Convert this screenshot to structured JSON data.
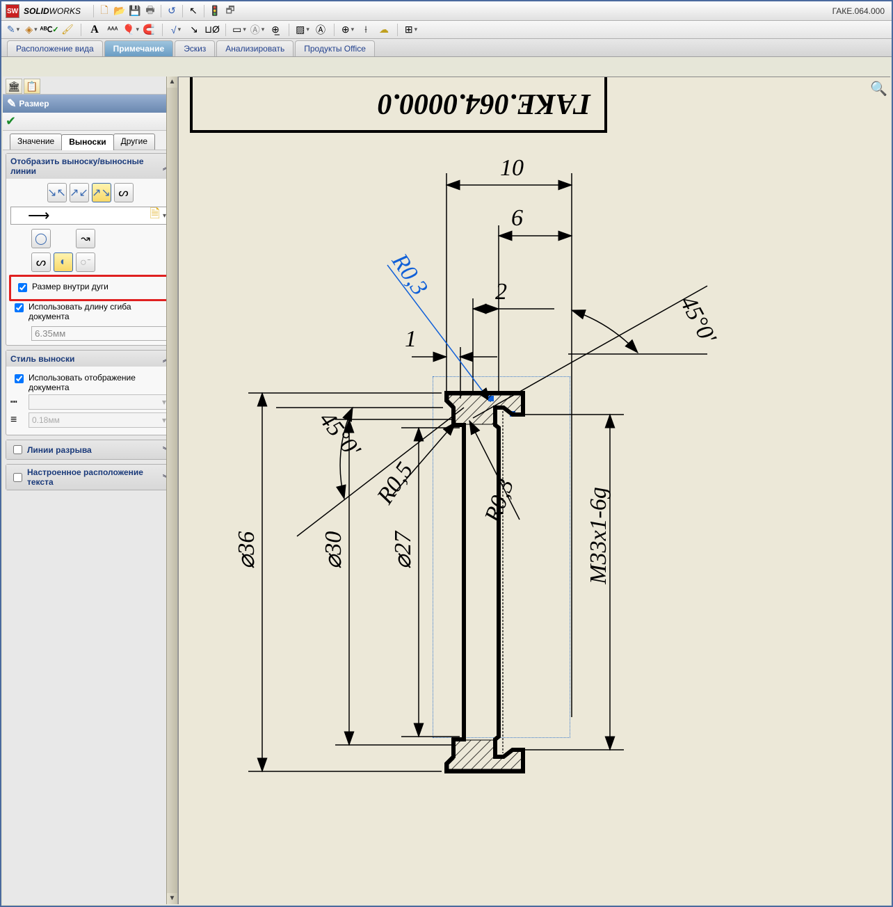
{
  "brand": {
    "b1": "SOLID",
    "b2": "WORKS"
  },
  "title_right": "ГАКЕ.064.000",
  "tabs": {
    "t1": "Расположение вида",
    "t2": "Примечание",
    "t3": "Эскиз",
    "t4": "Анализировать",
    "t5": "Продукты Office"
  },
  "prop_mgr": {
    "title": "Размер",
    "help": "?",
    "sub_tabs": {
      "value": "Значение",
      "leaders": "Выноски",
      "other": "Другие"
    },
    "group_leader_display": {
      "title": "Отобразить выноску/выносные линии",
      "check_dim_inside_arc": "Размер внутри дуги",
      "check_use_doc_bend": "Использовать длину сгиба документа",
      "bend_value": "6.35мм"
    },
    "group_leader_style": {
      "title": "Стиль выноски",
      "check_use_doc_display": "Использовать отображение документа",
      "thickness_value": "0.18мм"
    },
    "group_break": {
      "title": "Линии разрыва"
    },
    "group_custom_text": {
      "title": "Настроенное расположение текста"
    }
  },
  "drawing": {
    "title_block_text": "ГАКЕ.064.0000.0",
    "dim_10": "10",
    "dim_6": "6",
    "dim_2": "2",
    "dim_1": "1",
    "dim_R03_sel": "R0,3",
    "dim_R03": "R0,3",
    "dim_R05": "R0,5",
    "dim_45a": "45°0'",
    "dim_45b": "45°0'",
    "dim_d36": "36",
    "dim_d30": "30",
    "dim_d27": "27",
    "dim_thread": "M33x1-6g"
  }
}
